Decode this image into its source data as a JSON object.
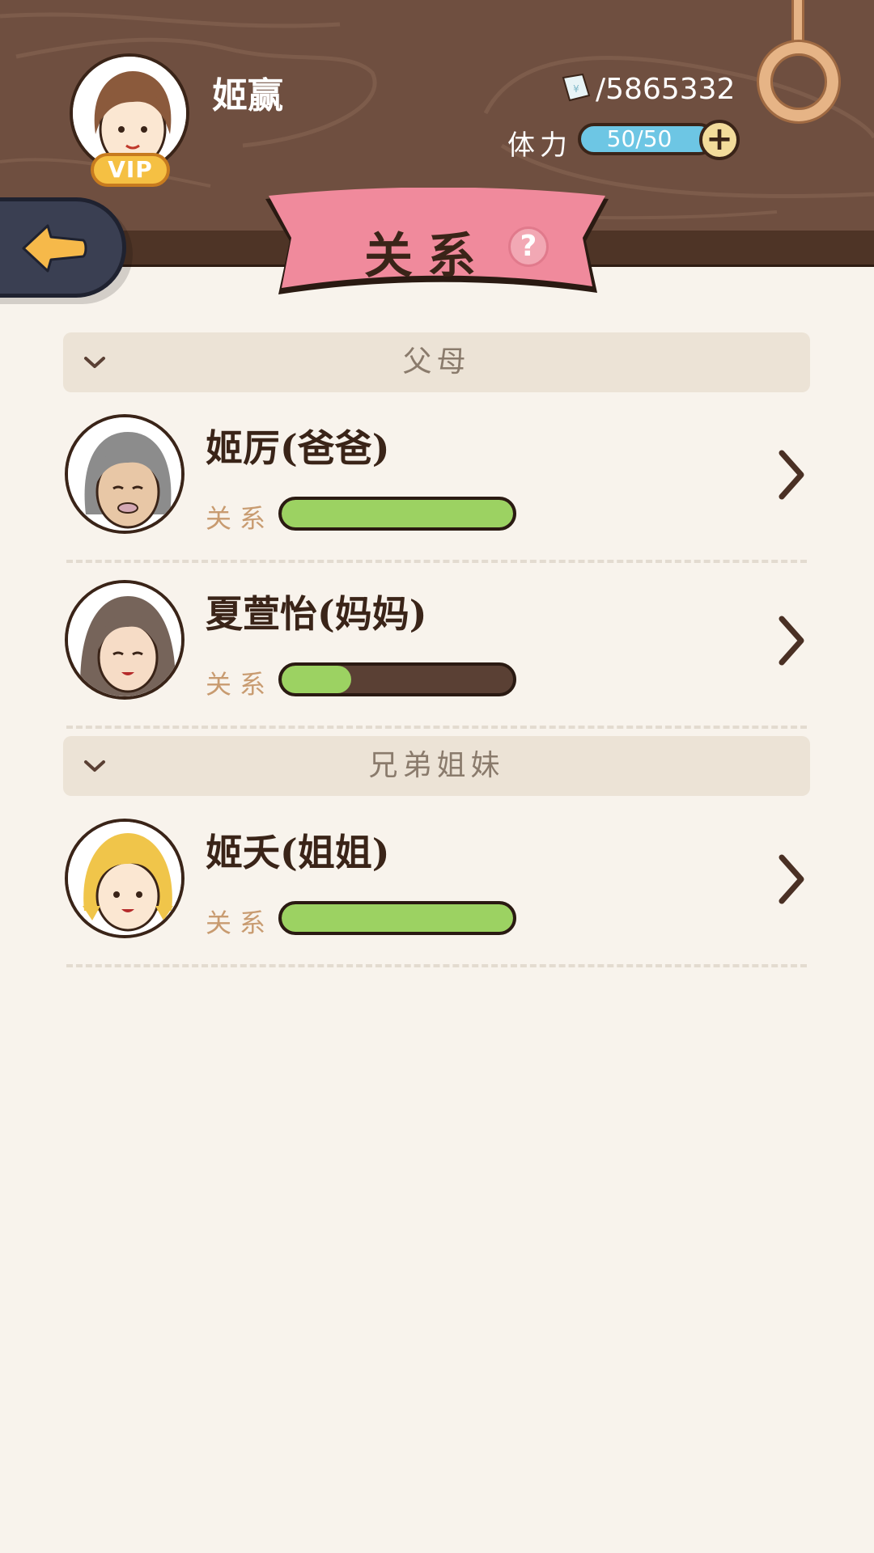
{
  "header": {
    "player_name": "姬赢",
    "vip_label": "VIP",
    "money_value": "/5865332",
    "stamina_label": "体力",
    "stamina_value": "50/50",
    "stamina_plus": "+",
    "title": "关系",
    "help_label": "?"
  },
  "sections": [
    {
      "title": "父母",
      "members": [
        {
          "name": "姬厉(爸爸)",
          "relation_label": "关系",
          "relation_level": 1.0
        },
        {
          "name": "夏萱怡(妈妈)",
          "relation_label": "关系",
          "relation_level": 0.3
        }
      ]
    },
    {
      "title": "兄弟姐妹",
      "members": [
        {
          "name": "姬夭(姐姐)",
          "relation_label": "关系",
          "relation_level": 1.0
        }
      ]
    }
  ],
  "colors": {
    "wood": "#6f4f40",
    "banner": "#f08a9c",
    "bar_fill": "#9cd262",
    "bar_empty": "#5a4034",
    "stamina_bar": "#6dc6e4"
  },
  "icons": {
    "back": "arrow-left-icon",
    "money": "banknote-icon",
    "ring": "ring-icon",
    "expand": "chevron-down-icon",
    "row_arrow": "chevron-right-icon"
  }
}
